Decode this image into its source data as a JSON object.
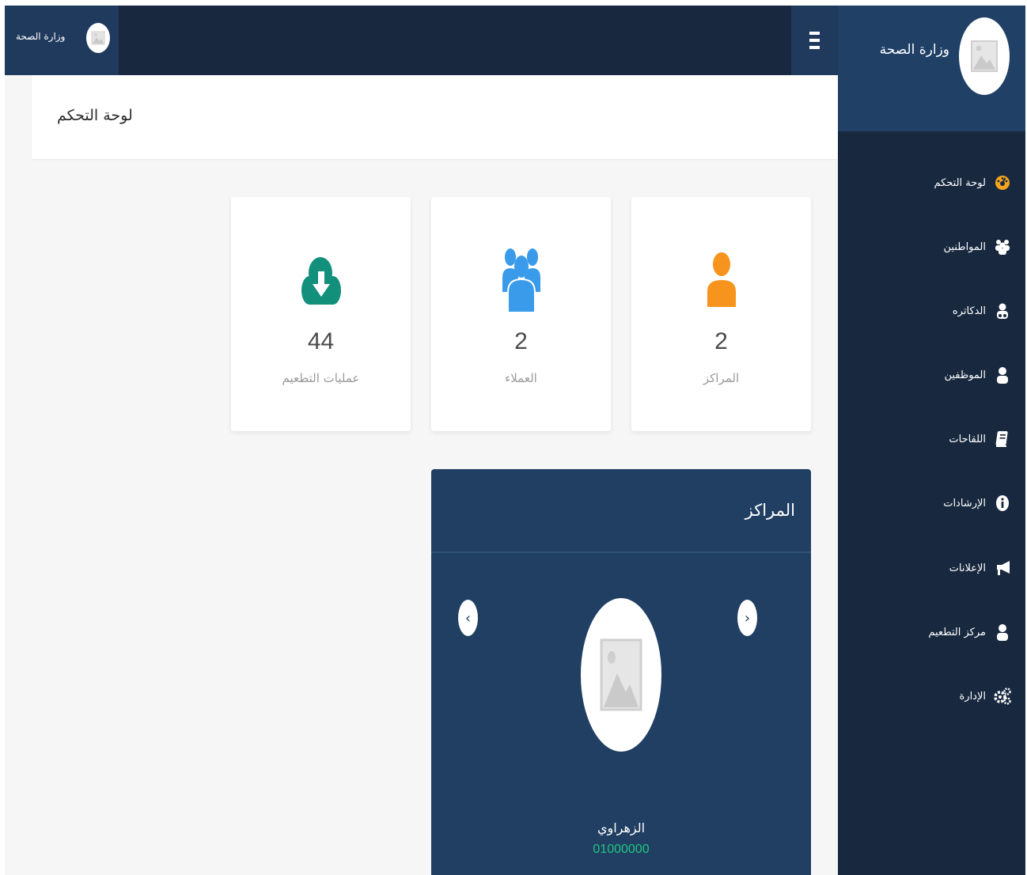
{
  "topbar": {
    "user_name": "وزارة الصحة"
  },
  "sidebar": {
    "brand_name": "وزارة الصحة",
    "items": [
      {
        "label": "لوحة التحكم",
        "icon": "dashboard-icon",
        "active": true
      },
      {
        "label": "المواطنين",
        "icon": "users-icon"
      },
      {
        "label": "الدكاتره",
        "icon": "doctor-icon"
      },
      {
        "label": "الموظفين",
        "icon": "user-icon"
      },
      {
        "label": "اللقاحات",
        "icon": "book-icon"
      },
      {
        "label": "الإرشادات",
        "icon": "info-icon"
      },
      {
        "label": "الإعلانات",
        "icon": "bullhorn-icon"
      },
      {
        "label": "مركز التطعيم",
        "icon": "user-icon"
      },
      {
        "label": "الإدارة",
        "icon": "cogs-icon"
      }
    ]
  },
  "header": {
    "title": "لوحة التحكم"
  },
  "stats": [
    {
      "value": "2",
      "label": "المراكز",
      "icon": "user-icon",
      "color": "#f7941d"
    },
    {
      "value": "2",
      "label": "العملاء",
      "icon": "users-icon",
      "color": "#3a9bea"
    },
    {
      "value": "44",
      "label": "عمليات التطعيم",
      "icon": "cloud-download-icon",
      "color": "#12907c"
    }
  ],
  "centers": {
    "title": "المراكز",
    "prev_arrow": "‹",
    "next_arrow": "›",
    "current": {
      "name": "الزهراوي",
      "phone": "01000000"
    }
  },
  "colors": {
    "sidebar_bg": "#18293f",
    "brand_bg": "#214066",
    "panel_bg": "#203f62",
    "phone_green": "#23c483",
    "active_icon": "#f7a41d"
  }
}
